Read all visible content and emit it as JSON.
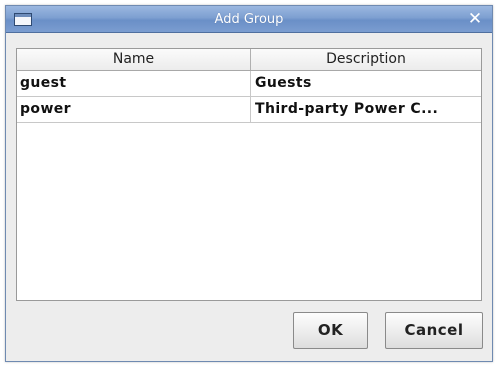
{
  "window": {
    "title": "Add Group",
    "close_glyph": "✕"
  },
  "table": {
    "columns": [
      "Name",
      "Description"
    ],
    "rows": [
      {
        "name": "guest",
        "description": "Guests"
      },
      {
        "name": "power",
        "description": "Third-party Power C..."
      }
    ]
  },
  "buttons": {
    "ok_label": "OK",
    "cancel_label": "Cancel"
  },
  "colors": {
    "titlebar": "#7d9fd1",
    "window_bg": "#ededed"
  },
  "icons": {
    "window_icon": "window-icon",
    "close_icon": "close-icon"
  }
}
